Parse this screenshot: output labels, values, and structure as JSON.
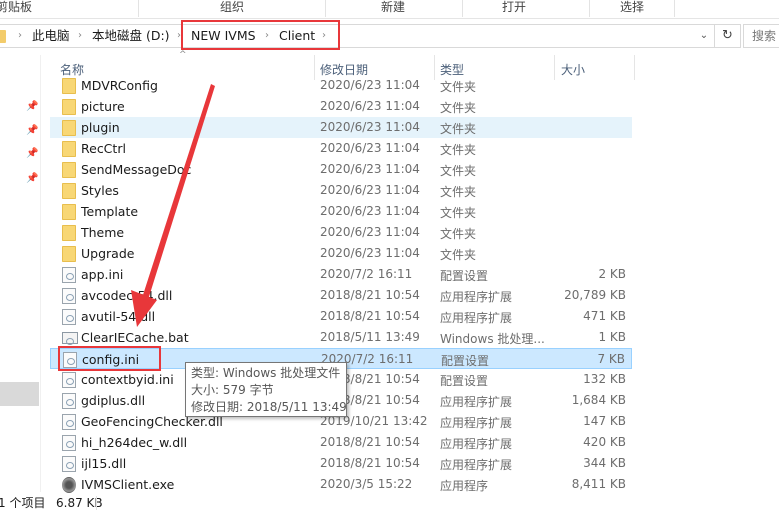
{
  "ribbon": {
    "groups": [
      "剪贴板",
      "组织",
      "新建",
      "打开",
      "选择"
    ]
  },
  "address_bar": {
    "crumbs": [
      "此电脑",
      "本地磁盘 (D:)",
      "NEW IVMS",
      "Client"
    ],
    "dropdown_icon": "chevron-down-icon",
    "refresh_icon": "refresh-icon",
    "search_placeholder": "搜索"
  },
  "columns": {
    "name": "名称",
    "modified": "修改日期",
    "type": "类型",
    "size": "大小"
  },
  "files": [
    {
      "name": "MDVRConfig",
      "modified": "2020/6/23 11:04",
      "type": "文件夹",
      "size": "",
      "icon": "folder-icon"
    },
    {
      "name": "picture",
      "modified": "2020/6/23 11:04",
      "type": "文件夹",
      "size": "",
      "icon": "folder-icon"
    },
    {
      "name": "plugin",
      "modified": "2020/6/23 11:04",
      "type": "文件夹",
      "size": "",
      "icon": "folder-icon",
      "state": "hover"
    },
    {
      "name": "RecCtrl",
      "modified": "2020/6/23 11:04",
      "type": "文件夹",
      "size": "",
      "icon": "folder-icon"
    },
    {
      "name": "SendMessageDoc",
      "modified": "2020/6/23 11:04",
      "type": "文件夹",
      "size": "",
      "icon": "folder-icon"
    },
    {
      "name": "Styles",
      "modified": "2020/6/23 11:04",
      "type": "文件夹",
      "size": "",
      "icon": "folder-icon"
    },
    {
      "name": "Template",
      "modified": "2020/6/23 11:04",
      "type": "文件夹",
      "size": "",
      "icon": "folder-icon"
    },
    {
      "name": "Theme",
      "modified": "2020/6/23 11:04",
      "type": "文件夹",
      "size": "",
      "icon": "folder-icon"
    },
    {
      "name": "Upgrade",
      "modified": "2020/6/23 11:04",
      "type": "文件夹",
      "size": "",
      "icon": "folder-icon"
    },
    {
      "name": "app.ini",
      "modified": "2020/7/2 16:11",
      "type": "配置设置",
      "size": "2 KB",
      "icon": "ini-file-icon"
    },
    {
      "name": "avcodec-54.dll",
      "modified": "2018/8/21 10:54",
      "type": "应用程序扩展",
      "size": "20,789 KB",
      "icon": "dll-file-icon"
    },
    {
      "name": "avutil-54.dll",
      "modified": "2018/8/21 10:54",
      "type": "应用程序扩展",
      "size": "471 KB",
      "icon": "dll-file-icon"
    },
    {
      "name": "ClearIECache.bat",
      "modified": "2018/5/11 13:49",
      "type": "Windows 批处理...",
      "size": "1 KB",
      "icon": "bat-file-icon"
    },
    {
      "name": "config.ini",
      "modified": "2020/7/2 16:11",
      "type": "配置设置",
      "size": "7 KB",
      "icon": "ini-file-icon",
      "state": "selected"
    },
    {
      "name": "contextbyid.ini",
      "modified": "2018/8/21 10:54",
      "type": "配置设置",
      "size": "132 KB",
      "icon": "ini-file-icon"
    },
    {
      "name": "gdiplus.dll",
      "modified": "2018/8/21 10:54",
      "type": "应用程序扩展",
      "size": "1,684 KB",
      "icon": "dll-file-icon"
    },
    {
      "name": "GeoFencingChecker.dll",
      "modified": "2019/10/21 13:42",
      "type": "应用程序扩展",
      "size": "147 KB",
      "icon": "dll-file-icon"
    },
    {
      "name": "hi_h264dec_w.dll",
      "modified": "2018/8/21 10:54",
      "type": "应用程序扩展",
      "size": "420 KB",
      "icon": "dll-file-icon"
    },
    {
      "name": "ijl15.dll",
      "modified": "2018/8/21 10:54",
      "type": "应用程序扩展",
      "size": "344 KB",
      "icon": "dll-file-icon"
    },
    {
      "name": "IVMSClient.exe",
      "modified": "2020/3/5 15:22",
      "type": "应用程序",
      "size": "8,411 KB",
      "icon": "exe-file-icon"
    }
  ],
  "tooltip": {
    "type_line": "类型: Windows 批处理文件",
    "size_line": "大小: 579 字节",
    "modified_line": "修改日期: 2018/5/11 13:49"
  },
  "status_bar": {
    "count": "1 个项目",
    "selected_size": "6.87 KB"
  },
  "annotation_color": "#e8373a"
}
